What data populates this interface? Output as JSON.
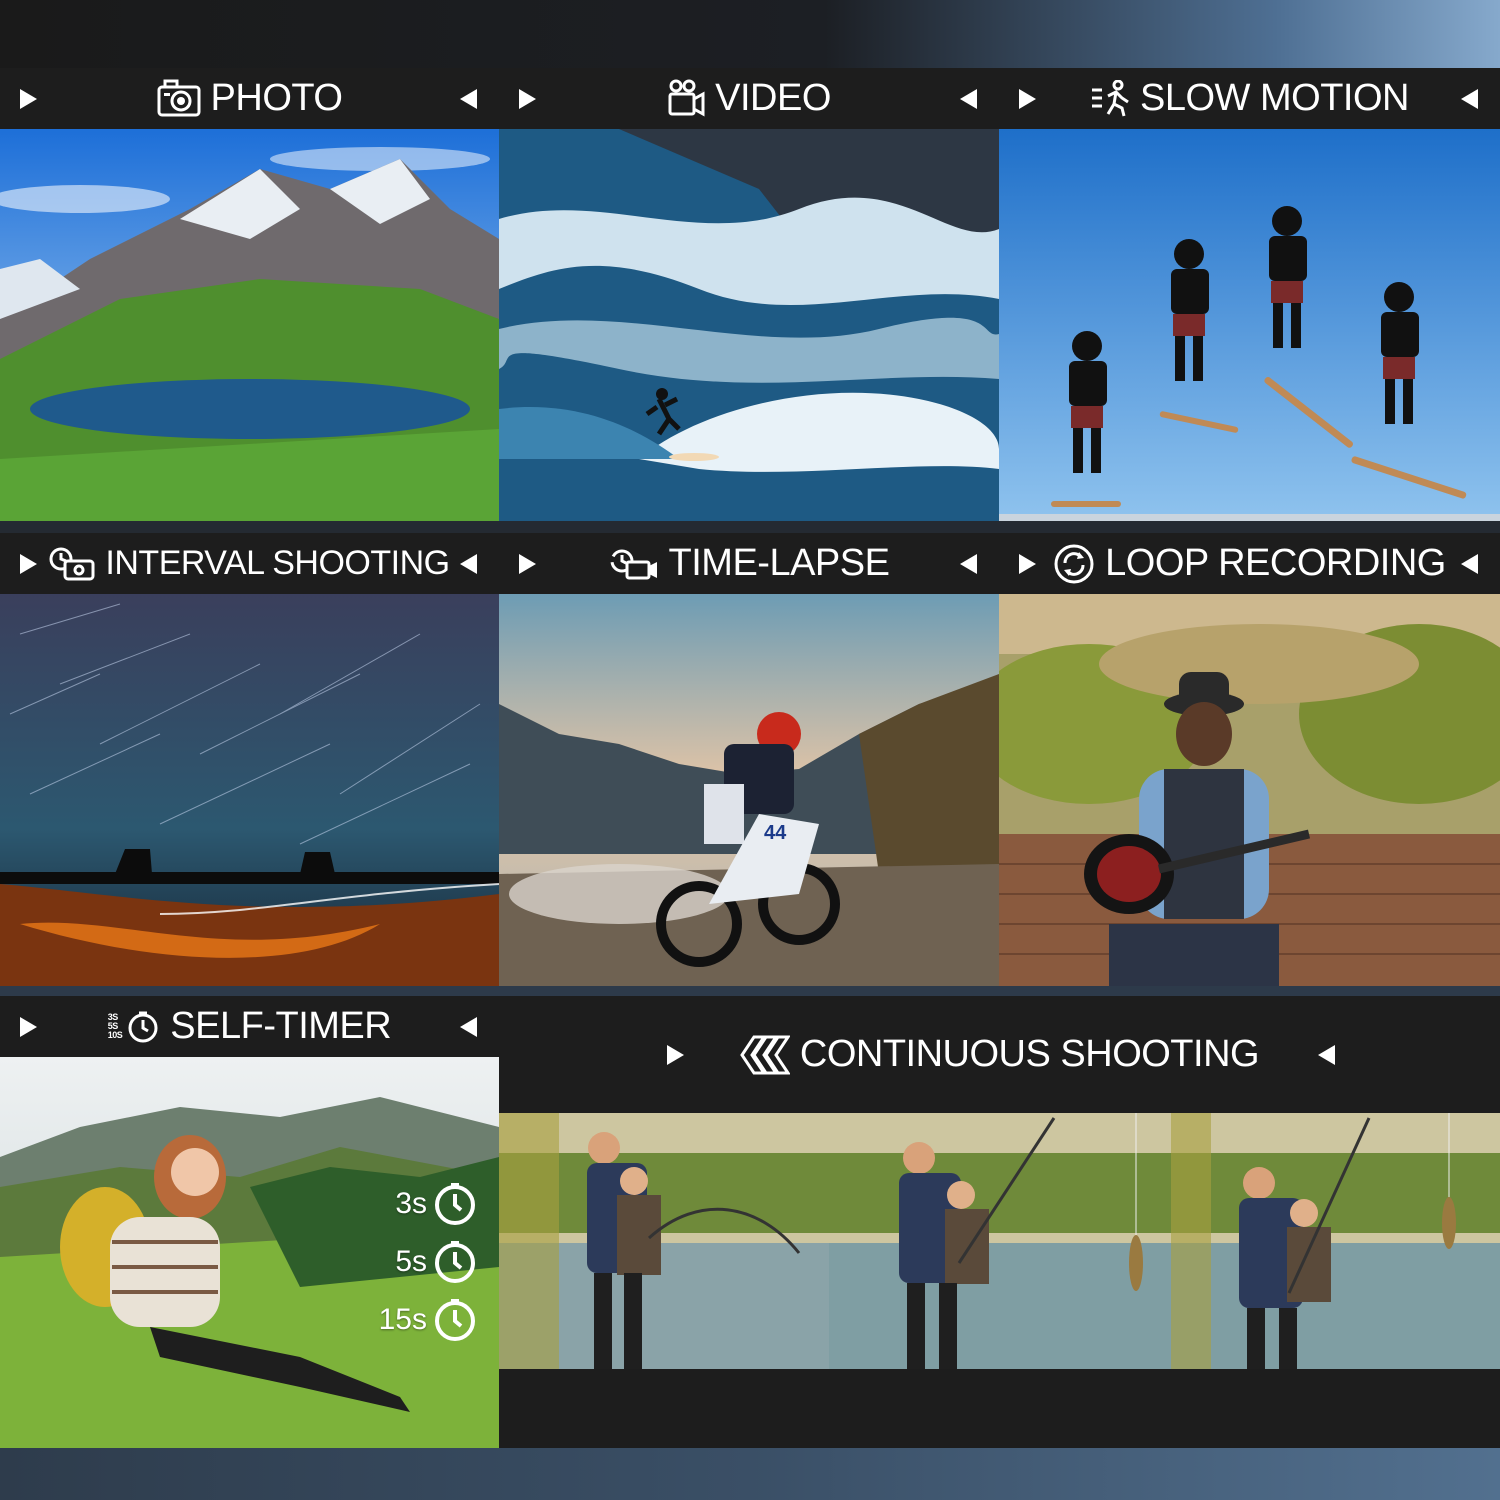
{
  "modes": {
    "photo": {
      "label": "PHOTO",
      "icon": "camera-icon"
    },
    "video": {
      "label": "VIDEO",
      "icon": "video-camera-icon"
    },
    "slow_motion": {
      "label": "SLOW MOTION",
      "icon": "running-person-icon"
    },
    "interval_shooting": {
      "label": "INTERVAL SHOOTING",
      "icon": "interval-camera-icon"
    },
    "time_lapse": {
      "label": "TIME-LAPSE",
      "icon": "timelapse-camera-icon"
    },
    "loop_recording": {
      "label": "LOOP RECORDING",
      "icon": "loop-icon"
    },
    "self_timer": {
      "label": "SELF-TIMER",
      "icon": "timer-icon",
      "badge": [
        "3S",
        "5S",
        "10S"
      ]
    },
    "continuous_shooting": {
      "label": "CONTINUOUS SHOOTING",
      "icon": "layers-icon"
    }
  },
  "self_timer_options": [
    "3s",
    "5s",
    "15s"
  ],
  "colors": {
    "header_bg": "#1d1d1d",
    "text": "#ffffff"
  }
}
